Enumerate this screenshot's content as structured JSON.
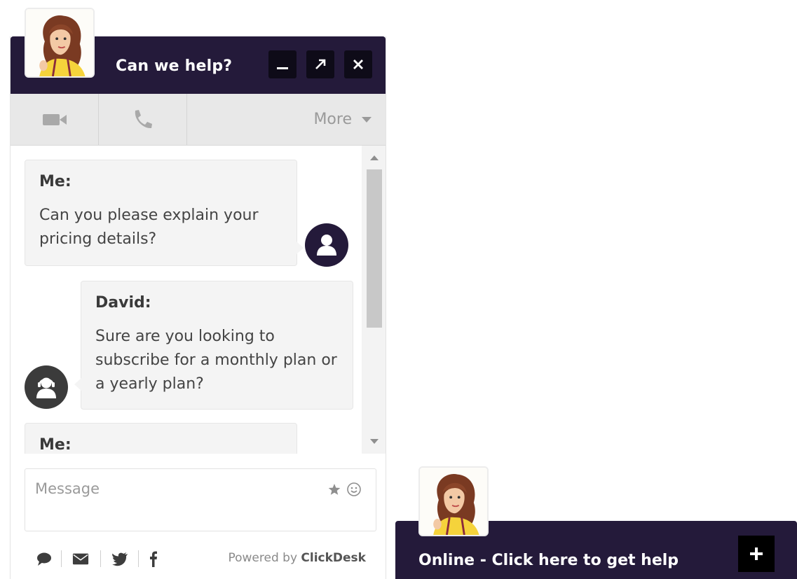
{
  "header": {
    "title": "Can we help?",
    "buttons": [
      {
        "name": "minimize",
        "icon": "minimize-icon"
      },
      {
        "name": "popout",
        "icon": "popout-arrow-icon"
      },
      {
        "name": "close",
        "icon": "close-icon"
      }
    ]
  },
  "toolbar": {
    "video_icon": "video-camera-icon",
    "phone_icon": "phone-icon",
    "more_label": "More"
  },
  "messages": [
    {
      "sender": "Me:",
      "text": "Can you please explain your pricing details?"
    },
    {
      "sender": "David:",
      "text": "Sure are you looking to subscribe for a monthly plan or a yearly plan?"
    },
    {
      "sender": "Me:",
      "text": ""
    }
  ],
  "composer": {
    "placeholder": "Message",
    "icons": [
      "star-icon",
      "smiley-icon"
    ]
  },
  "footer": {
    "icons": [
      "chat-bubble-icon",
      "envelope-icon",
      "twitter-icon",
      "facebook-icon"
    ],
    "powered_prefix": "Powered by",
    "powered_brand": "ClickDesk"
  },
  "launcher": {
    "label": "Online - Click here to get help",
    "icon": "plus-icon"
  },
  "colors": {
    "brand_dark": "#241a3a",
    "button_dark": "#0e0b18",
    "bubble_bg": "#f4f4f4",
    "toolbar_bg": "#e8e8e8"
  }
}
